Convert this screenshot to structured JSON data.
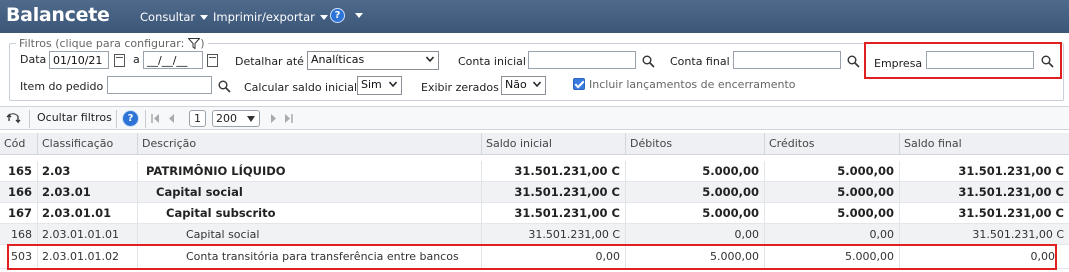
{
  "header": {
    "title": "Balancete",
    "menu_consultar": "Consultar",
    "menu_imprimir": "Imprimir/exportar",
    "help_glyph": "?"
  },
  "filters": {
    "legend": "Filtros (clique para configurar:",
    "data_label": "Data",
    "data_from": "01/10/21",
    "a_label": "a",
    "data_to": "__/__/__",
    "detalhar_label": "Detalhar até",
    "detalhar_value": "Analíticas",
    "conta_inicial_label": "Conta inicial",
    "conta_inicial_value": "",
    "conta_final_label": "Conta final",
    "conta_final_value": "",
    "empresa_label": "Empresa",
    "empresa_value": "",
    "item_pedido_label": "Item do pedido",
    "item_pedido_value": "",
    "calcular_label": "Calcular saldo inicial",
    "calcular_value": "Sim",
    "exibir_label": "Exibir zerados",
    "exibir_value": "Não",
    "incluir_label": "Incluir lançamentos de encerramento",
    "incluir_checked": true
  },
  "toolbar": {
    "ocultar_label": "Ocultar filtros",
    "page": "1",
    "page_size": "200"
  },
  "table": {
    "columns": [
      "Cód",
      "Classificação",
      "Descrição",
      "Saldo inicial",
      "Débitos",
      "Créditos",
      "Saldo final"
    ],
    "rows": [
      {
        "cod": "165",
        "classificacao": "2.03",
        "descricao": "PATRIMÔNIO LÍQUIDO",
        "saldo_inicial": "31.501.231,00 C",
        "debitos": "5.000,00",
        "creditos": "5.000,00",
        "saldo_final": "31.501.231,00 C"
      },
      {
        "cod": "166",
        "classificacao": "2.03.01",
        "descricao": "Capital social",
        "saldo_inicial": "31.501.231,00 C",
        "debitos": "5.000,00",
        "creditos": "5.000,00",
        "saldo_final": "31.501.231,00 C"
      },
      {
        "cod": "167",
        "classificacao": "2.03.01.01",
        "descricao": "Capital subscrito",
        "saldo_inicial": "31.501.231,00 C",
        "debitos": "5.000,00",
        "creditos": "5.000,00",
        "saldo_final": "31.501.231,00 C"
      },
      {
        "cod": "168",
        "classificacao": "2.03.01.01.01",
        "descricao": "Capital social",
        "saldo_inicial": "31.501.231,00 C",
        "debitos": "0,00",
        "creditos": "0,00",
        "saldo_final": "31.501.231,00 C"
      },
      {
        "cod": "503",
        "classificacao": "2.03.01.01.02",
        "descricao": "Conta transitória para transferência entre bancos",
        "saldo_inicial": "0,00",
        "debitos": "5.000,00",
        "creditos": "5.000,00",
        "saldo_final": "0,00"
      }
    ]
  },
  "colors": {
    "header_bg": "#3b5677",
    "highlight": "#e02020",
    "checkbox": "#3a7be0"
  }
}
